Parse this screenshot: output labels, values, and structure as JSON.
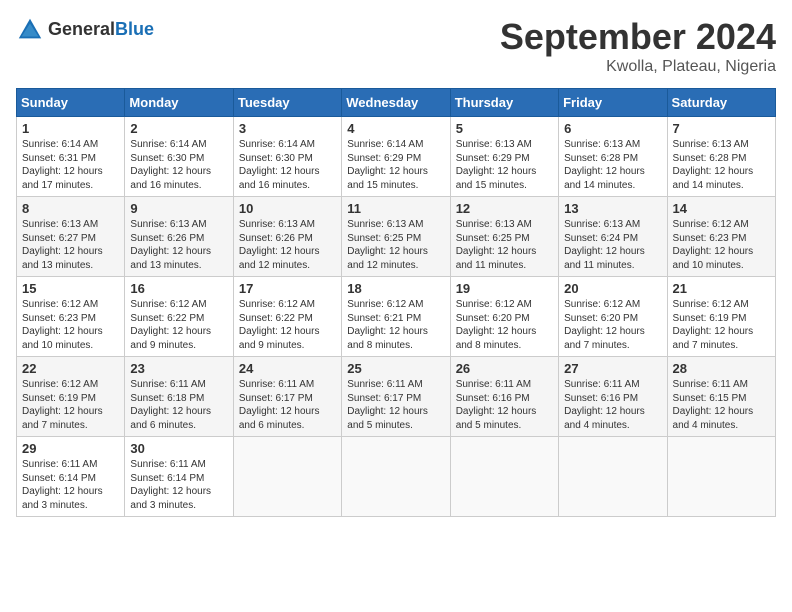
{
  "header": {
    "logo_general": "General",
    "logo_blue": "Blue",
    "month_year": "September 2024",
    "location": "Kwolla, Plateau, Nigeria"
  },
  "days_of_week": [
    "Sunday",
    "Monday",
    "Tuesday",
    "Wednesday",
    "Thursday",
    "Friday",
    "Saturday"
  ],
  "weeks": [
    [
      {
        "day": "1",
        "sunrise": "6:14 AM",
        "sunset": "6:31 PM",
        "daylight": "12 hours and 17 minutes."
      },
      {
        "day": "2",
        "sunrise": "6:14 AM",
        "sunset": "6:30 PM",
        "daylight": "12 hours and 16 minutes."
      },
      {
        "day": "3",
        "sunrise": "6:14 AM",
        "sunset": "6:30 PM",
        "daylight": "12 hours and 16 minutes."
      },
      {
        "day": "4",
        "sunrise": "6:14 AM",
        "sunset": "6:29 PM",
        "daylight": "12 hours and 15 minutes."
      },
      {
        "day": "5",
        "sunrise": "6:13 AM",
        "sunset": "6:29 PM",
        "daylight": "12 hours and 15 minutes."
      },
      {
        "day": "6",
        "sunrise": "6:13 AM",
        "sunset": "6:28 PM",
        "daylight": "12 hours and 14 minutes."
      },
      {
        "day": "7",
        "sunrise": "6:13 AM",
        "sunset": "6:28 PM",
        "daylight": "12 hours and 14 minutes."
      }
    ],
    [
      {
        "day": "8",
        "sunrise": "6:13 AM",
        "sunset": "6:27 PM",
        "daylight": "12 hours and 13 minutes."
      },
      {
        "day": "9",
        "sunrise": "6:13 AM",
        "sunset": "6:26 PM",
        "daylight": "12 hours and 13 minutes."
      },
      {
        "day": "10",
        "sunrise": "6:13 AM",
        "sunset": "6:26 PM",
        "daylight": "12 hours and 12 minutes."
      },
      {
        "day": "11",
        "sunrise": "6:13 AM",
        "sunset": "6:25 PM",
        "daylight": "12 hours and 12 minutes."
      },
      {
        "day": "12",
        "sunrise": "6:13 AM",
        "sunset": "6:25 PM",
        "daylight": "12 hours and 11 minutes."
      },
      {
        "day": "13",
        "sunrise": "6:13 AM",
        "sunset": "6:24 PM",
        "daylight": "12 hours and 11 minutes."
      },
      {
        "day": "14",
        "sunrise": "6:12 AM",
        "sunset": "6:23 PM",
        "daylight": "12 hours and 10 minutes."
      }
    ],
    [
      {
        "day": "15",
        "sunrise": "6:12 AM",
        "sunset": "6:23 PM",
        "daylight": "12 hours and 10 minutes."
      },
      {
        "day": "16",
        "sunrise": "6:12 AM",
        "sunset": "6:22 PM",
        "daylight": "12 hours and 9 minutes."
      },
      {
        "day": "17",
        "sunrise": "6:12 AM",
        "sunset": "6:22 PM",
        "daylight": "12 hours and 9 minutes."
      },
      {
        "day": "18",
        "sunrise": "6:12 AM",
        "sunset": "6:21 PM",
        "daylight": "12 hours and 8 minutes."
      },
      {
        "day": "19",
        "sunrise": "6:12 AM",
        "sunset": "6:20 PM",
        "daylight": "12 hours and 8 minutes."
      },
      {
        "day": "20",
        "sunrise": "6:12 AM",
        "sunset": "6:20 PM",
        "daylight": "12 hours and 7 minutes."
      },
      {
        "day": "21",
        "sunrise": "6:12 AM",
        "sunset": "6:19 PM",
        "daylight": "12 hours and 7 minutes."
      }
    ],
    [
      {
        "day": "22",
        "sunrise": "6:12 AM",
        "sunset": "6:19 PM",
        "daylight": "12 hours and 7 minutes."
      },
      {
        "day": "23",
        "sunrise": "6:11 AM",
        "sunset": "6:18 PM",
        "daylight": "12 hours and 6 minutes."
      },
      {
        "day": "24",
        "sunrise": "6:11 AM",
        "sunset": "6:17 PM",
        "daylight": "12 hours and 6 minutes."
      },
      {
        "day": "25",
        "sunrise": "6:11 AM",
        "sunset": "6:17 PM",
        "daylight": "12 hours and 5 minutes."
      },
      {
        "day": "26",
        "sunrise": "6:11 AM",
        "sunset": "6:16 PM",
        "daylight": "12 hours and 5 minutes."
      },
      {
        "day": "27",
        "sunrise": "6:11 AM",
        "sunset": "6:16 PM",
        "daylight": "12 hours and 4 minutes."
      },
      {
        "day": "28",
        "sunrise": "6:11 AM",
        "sunset": "6:15 PM",
        "daylight": "12 hours and 4 minutes."
      }
    ],
    [
      {
        "day": "29",
        "sunrise": "6:11 AM",
        "sunset": "6:14 PM",
        "daylight": "12 hours and 3 minutes."
      },
      {
        "day": "30",
        "sunrise": "6:11 AM",
        "sunset": "6:14 PM",
        "daylight": "12 hours and 3 minutes."
      },
      null,
      null,
      null,
      null,
      null
    ]
  ],
  "labels": {
    "sunrise": "Sunrise:",
    "sunset": "Sunset:",
    "daylight": "Daylight:"
  }
}
